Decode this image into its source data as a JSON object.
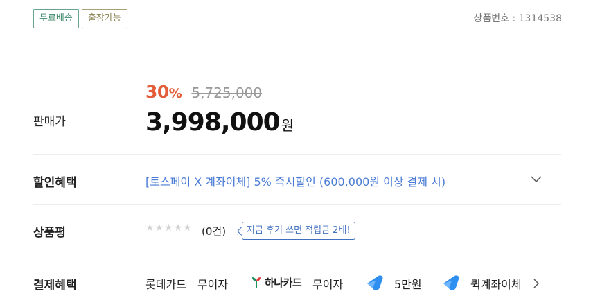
{
  "badges": [
    "무료배송",
    "출장가능"
  ],
  "product_no": "상품번호 : 1314538",
  "price": {
    "label": "판매가",
    "discount_rate": "30",
    "discount_unit": "%",
    "original": "5,725,000",
    "sale": "3,998,000",
    "currency": "원"
  },
  "benefit": {
    "label": "할인혜택",
    "text": "[토스페이 X 계좌이체] 5% 즉시할인 (600,000원 이상 결제 시)"
  },
  "review": {
    "label": "상품평",
    "rating": 0,
    "count": "(0건)",
    "tooltip": "지금 후기 쓰면 적립금 2배!"
  },
  "payment": {
    "label": "결제혜택",
    "lotte_card": "롯데카드",
    "lotte_benefit": "무이자",
    "hana_card": "하나카드",
    "hana_benefit": "무이자",
    "toss_benefit_1": "5만원",
    "toss_benefit_2": "퀵계좌이체"
  },
  "colors": {
    "discount": "#e35d3a",
    "benefit_link": "#4a7cd6",
    "badge_green": "#3f8a6e",
    "badge_olive": "#8a8553",
    "toss_blue": "#2f8ff0"
  }
}
